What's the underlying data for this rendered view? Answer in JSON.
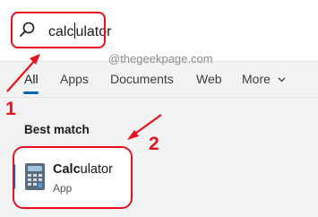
{
  "search": {
    "query_before_caret": "calc",
    "query_after_caret": "ulator"
  },
  "watermark": "@thegeekpage.com",
  "tabs": [
    {
      "label": "All"
    },
    {
      "label": "Apps"
    },
    {
      "label": "Documents"
    },
    {
      "label": "Web"
    },
    {
      "label": "More"
    }
  ],
  "section_title": "Best match",
  "result": {
    "name_bold": "Calc",
    "name_rest": "ulator",
    "type": "App"
  },
  "annotations": {
    "step1": "1",
    "step2": "2"
  },
  "colors": {
    "annotation_red": "#e8101c",
    "accent_blue": "#0067c0",
    "background": "#f3f3f3"
  },
  "icons": [
    "search-icon",
    "chevron-down-icon",
    "calculator-app-icon"
  ]
}
